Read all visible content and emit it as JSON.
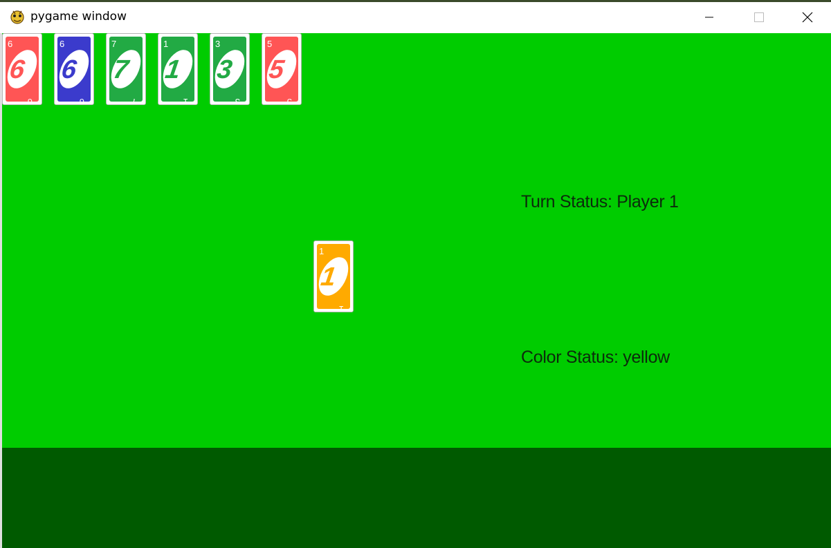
{
  "window": {
    "title": "pygame window"
  },
  "colors": {
    "table": "#00cc00",
    "bottom_area": "#005a00",
    "red": "#ff5555",
    "blue": "#3b3bcc",
    "green": "#22aa44",
    "yellow": "#ffaa00"
  },
  "hand": [
    {
      "value": "6",
      "color": "red"
    },
    {
      "value": "6",
      "color": "blue"
    },
    {
      "value": "7",
      "color": "green"
    },
    {
      "value": "1",
      "color": "green"
    },
    {
      "value": "3",
      "color": "green"
    },
    {
      "value": "5",
      "color": "red"
    }
  ],
  "discard": {
    "value": "1",
    "color": "yellow"
  },
  "status": {
    "turn": "Turn Status: Player 1",
    "color": "Color Status: yellow"
  }
}
